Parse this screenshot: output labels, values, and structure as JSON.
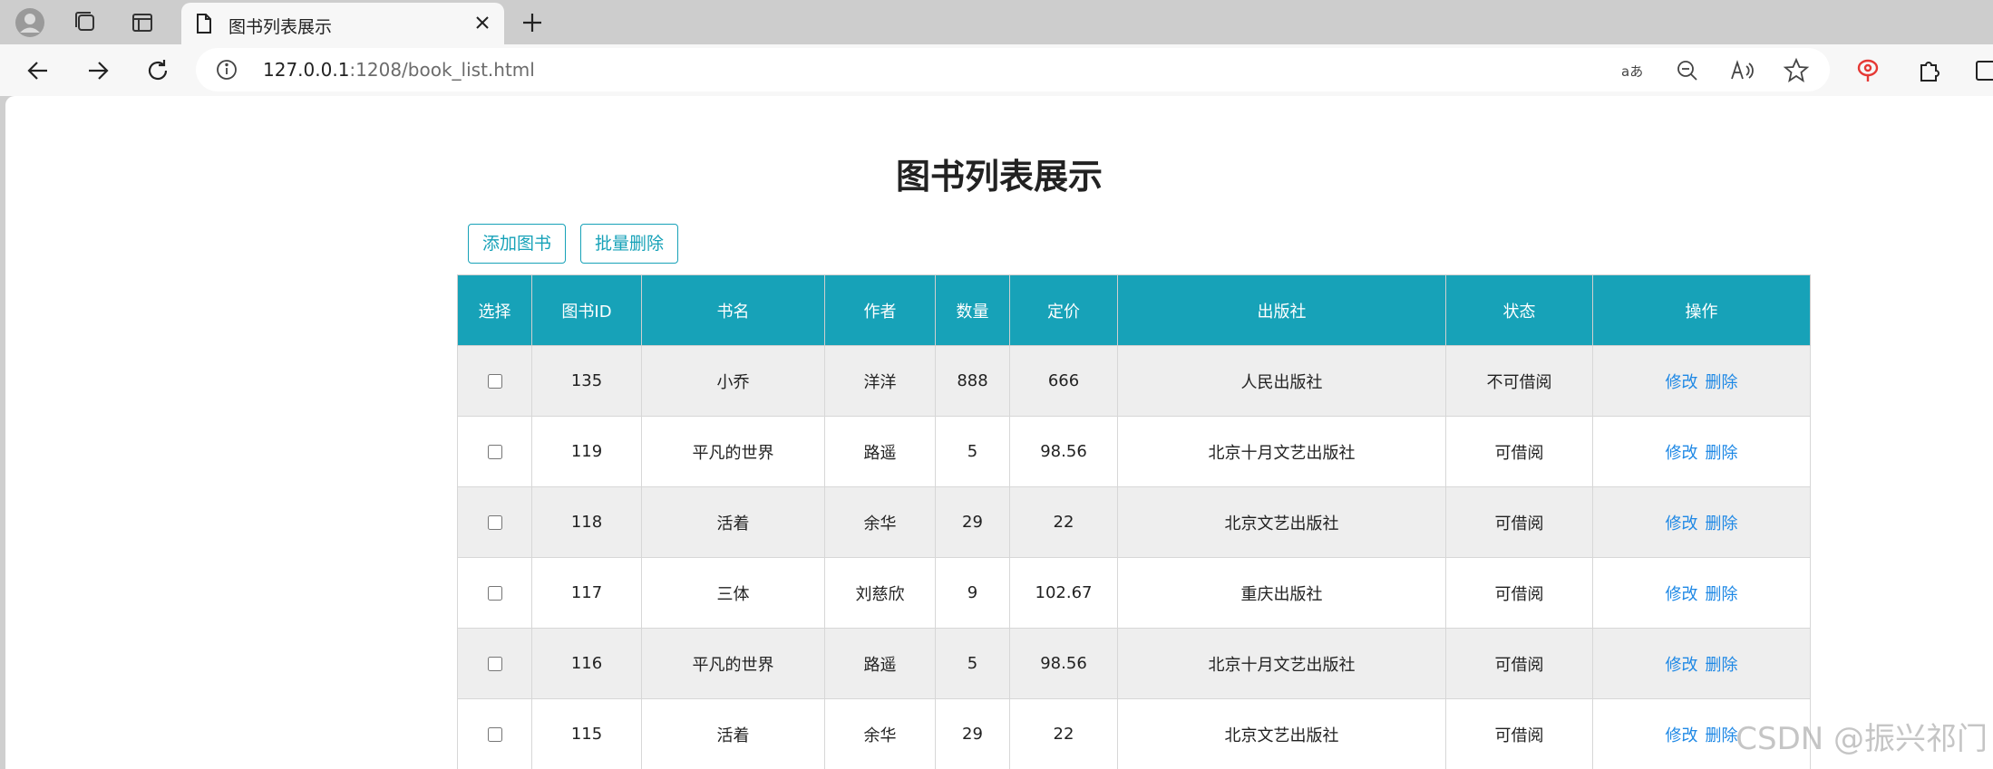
{
  "browser": {
    "tab_title": "图书列表展示",
    "url_host": "127.0.0.1",
    "url_rest": ":1208/book_list.html"
  },
  "page": {
    "title": "图书列表展示",
    "add_button": "添加图书",
    "batch_delete_button": "批量删除",
    "accent_color": "#17a2b8",
    "link_color": "#1e88e5"
  },
  "table": {
    "headers": [
      "选择",
      "图书ID",
      "书名",
      "作者",
      "数量",
      "定价",
      "出版社",
      "状态",
      "操作"
    ],
    "rows": [
      {
        "id": "135",
        "name": "小乔",
        "author": "洋洋",
        "count": "888",
        "price": "666",
        "publisher": "人民出版社",
        "status": "不可借阅"
      },
      {
        "id": "119",
        "name": "平凡的世界",
        "author": "路遥",
        "count": "5",
        "price": "98.56",
        "publisher": "北京十月文艺出版社",
        "status": "可借阅"
      },
      {
        "id": "118",
        "name": "活着",
        "author": "余华",
        "count": "29",
        "price": "22",
        "publisher": "北京文艺出版社",
        "status": "可借阅"
      },
      {
        "id": "117",
        "name": "三体",
        "author": "刘慈欣",
        "count": "9",
        "price": "102.67",
        "publisher": "重庆出版社",
        "status": "可借阅"
      },
      {
        "id": "116",
        "name": "平凡的世界",
        "author": "路遥",
        "count": "5",
        "price": "98.56",
        "publisher": "北京十月文艺出版社",
        "status": "可借阅"
      },
      {
        "id": "115",
        "name": "活着",
        "author": "余华",
        "count": "29",
        "price": "22",
        "publisher": "北京文艺出版社",
        "status": "可借阅"
      }
    ],
    "edit_label": "修改",
    "delete_label": "删除"
  },
  "watermark": "CSDN @振兴祁门"
}
